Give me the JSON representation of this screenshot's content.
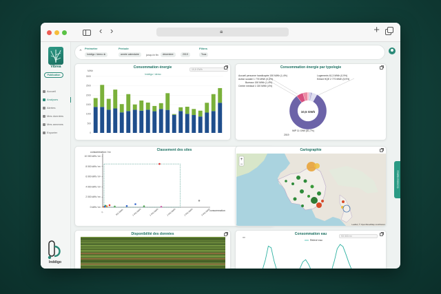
{
  "app": {
    "name": "Vibrea",
    "brand": "Inddigo",
    "publish_label": "Publication"
  },
  "sidebar": {
    "items": [
      {
        "label": "Accueil",
        "active": false
      },
      {
        "label": "Analyses",
        "active": true
      },
      {
        "label": "Alertes",
        "active": false
      },
      {
        "label": "Mes données",
        "active": false
      },
      {
        "label": "Mes annexes",
        "active": false
      },
      {
        "label": "Exporter",
        "active": false
      }
    ]
  },
  "filters": {
    "perimetre_label": "Périmètre",
    "perimetre_value": "Inddigo / demo",
    "periode_label": "Période",
    "periode_from": "année calendaire",
    "periode_sep": "jusqu'à fin",
    "periode_to": "décembre",
    "periode_year": "2019",
    "filtres_label": "Filtres",
    "filtres_value": "Tous"
  },
  "feedback_tab": "Commentaires",
  "energy_card": {
    "title": "Consommation énergie",
    "search_placeholder": "10,5 GWh",
    "legend": "Inddigo / demo",
    "unit": "MWh"
  },
  "typology_card": {
    "title": "Consommation énergie par typologie",
    "center": "10,5 GWh",
    "year": "2019",
    "labels": [
      "Accueil personne handicapée 150 MWh (1,4%)",
      "Action sociale 1 776 MWh (0,6%)",
      "Bureaux 150 MWh (1,4%)",
      "Centre médical 1 020 MWh (4%)",
      "Logements 61,3 MWh (0,9%)",
      "Enfant HQE 2 770 MWh (5,9%)",
      "IMP 11 GWh (81,7%)"
    ]
  },
  "ranking_card": {
    "title": "Classement des sites",
    "ylabel": "consommation / m²",
    "xlabel": "consommation"
  },
  "map_card": {
    "title": "Cartographie",
    "attribution": "Leaflet | © OpenStreetMap contributors",
    "zoom_in": "+",
    "zoom_out": "−"
  },
  "availability_card": {
    "title": "Disponibilité des données",
    "x_ticks": [
      "2019-01",
      "2019-02",
      "2019-03",
      "2019-04",
      "2019-05",
      "2019-06",
      "2019-07",
      "2019-08",
      "2019-09",
      "2019-10",
      "2019-11",
      "2019-12"
    ]
  },
  "water_card": {
    "title": "Consommation eau",
    "legend": "Relevé eau",
    "search_placeholder": "93 333 m³",
    "unit": "m³"
  },
  "chart_data": [
    {
      "type": "bar",
      "title": "Consommation énergie",
      "ylabel": "MWh",
      "ylim": [
        0,
        3000
      ],
      "y_ticks": [
        "0",
        "500",
        "1000",
        "1500",
        "2000",
        "2500",
        "3000"
      ],
      "categories": [
        "1",
        "2",
        "3",
        "4",
        "5",
        "6",
        "7",
        "8",
        "9",
        "10",
        "11",
        "12",
        "13",
        "14",
        "15",
        "16",
        "17",
        "18",
        "19",
        "20"
      ],
      "series": [
        {
          "color": "#1f4e8c",
          "values": [
            1380,
            1380,
            1230,
            1300,
            1090,
            1160,
            1230,
            1180,
            1230,
            1150,
            1270,
            1220,
            960,
            1160,
            1010,
            950,
            870,
            1080,
            1160,
            1600
          ]
        },
        {
          "color": "#7ab03a",
          "values": [
            470,
            1170,
            580,
            1000,
            440,
            900,
            280,
            540,
            380,
            280,
            310,
            890,
            40,
            200,
            380,
            320,
            310,
            520,
            900,
            780
          ]
        }
      ]
    },
    {
      "type": "pie",
      "title": "Consommation énergie par typologie",
      "values": [
        81.7,
        5.9,
        4,
        1.4,
        1.4,
        0.9,
        0.6,
        4.1
      ],
      "colors": [
        "#6c63a8",
        "#d64f7f",
        "#ec8aa4",
        "#f6b9c9",
        "#c9c6e0",
        "#a59fcf",
        "#8a83be",
        "#e0dff0"
      ]
    },
    {
      "type": "scatter",
      "title": "Classement des sites",
      "xlabel": "consommation",
      "ylabel": "consommation / m²",
      "ylim": [
        0,
        10000
      ],
      "y_ticks": [
        "0 kWh / m²",
        "2 000 kWh / m²",
        "4 000 kWh / m²",
        "6 000 kWh / m²",
        "8 000 kWh / m²",
        "10 000 kWh / m²"
      ],
      "x_ticks": [
        "0",
        "500 MWh",
        "1 000 MWh",
        "1 500 MWh",
        "2 000 MWh",
        "2 500 MWh",
        "3 000 MWh"
      ],
      "points": [
        {
          "x": 1650,
          "y": 8500,
          "color": "#d33"
        },
        {
          "x": 80,
          "y": 300,
          "color": "#2a6"
        },
        {
          "x": 120,
          "y": 200,
          "color": "#e83"
        },
        {
          "x": 200,
          "y": 400,
          "color": "#d33"
        },
        {
          "x": 350,
          "y": 150,
          "color": "#5a5"
        },
        {
          "x": 700,
          "y": 250,
          "color": "#36c"
        },
        {
          "x": 950,
          "y": 600,
          "color": "#36c"
        },
        {
          "x": 1200,
          "y": 200,
          "color": "#5a5"
        },
        {
          "x": 1700,
          "y": 100,
          "color": "#c6a"
        },
        {
          "x": 2800,
          "y": 1300,
          "color": "#999"
        },
        {
          "x": 30,
          "y": 80,
          "color": "#e83"
        },
        {
          "x": 60,
          "y": 120,
          "color": "#36c"
        }
      ]
    },
    {
      "type": "line",
      "title": "Consommation eau",
      "ylabel": "m³",
      "series": [
        {
          "name": "Relevé eau",
          "color": "#2ab0a0",
          "values": [
            0,
            0,
            0,
            0,
            1,
            3,
            12,
            30,
            55,
            52,
            28,
            10,
            4,
            2,
            1,
            0,
            0,
            1,
            4,
            14,
            26,
            30,
            22,
            10,
            3,
            1,
            0,
            0,
            1,
            3,
            10,
            28,
            50,
            58,
            54,
            40,
            25,
            12,
            5,
            2,
            1,
            0,
            0,
            0,
            0,
            0,
            0,
            0
          ]
        }
      ]
    }
  ]
}
